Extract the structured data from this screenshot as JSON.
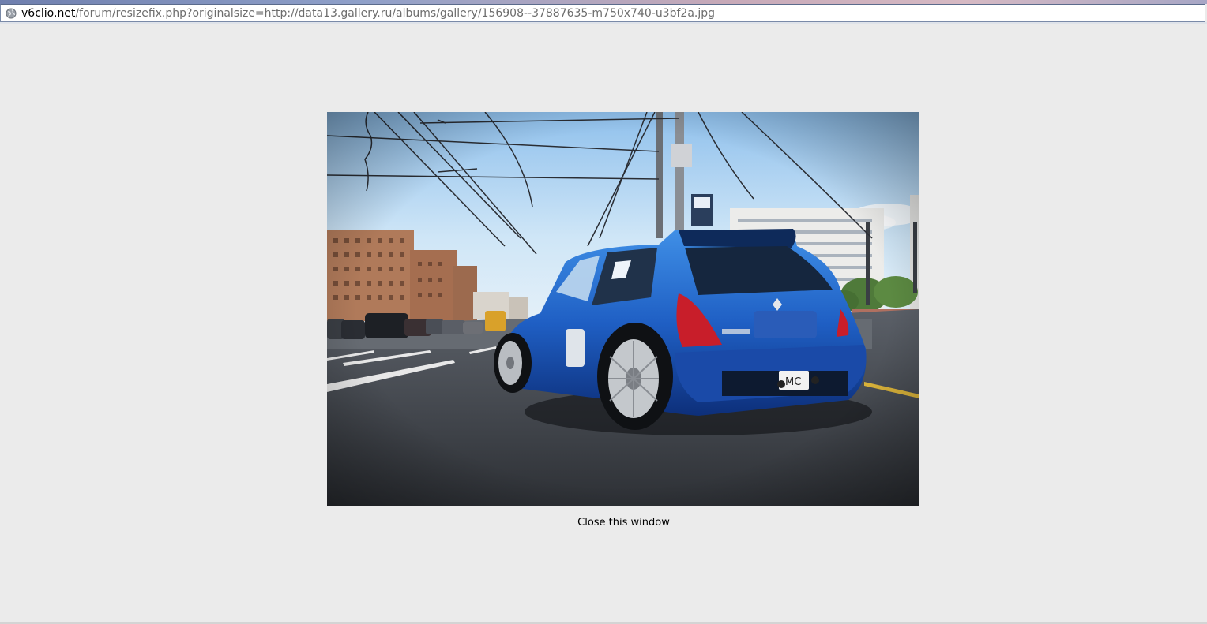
{
  "address_bar": {
    "domain": "v6clio.net",
    "path": "/forum/resizefix.php?originalsize=http://data13.gallery.ru/albums/gallery/156908--37887635-m750x740-u3bf2a.jpg"
  },
  "photo": {
    "plate": "MC"
  },
  "close_link": "Close this window"
}
